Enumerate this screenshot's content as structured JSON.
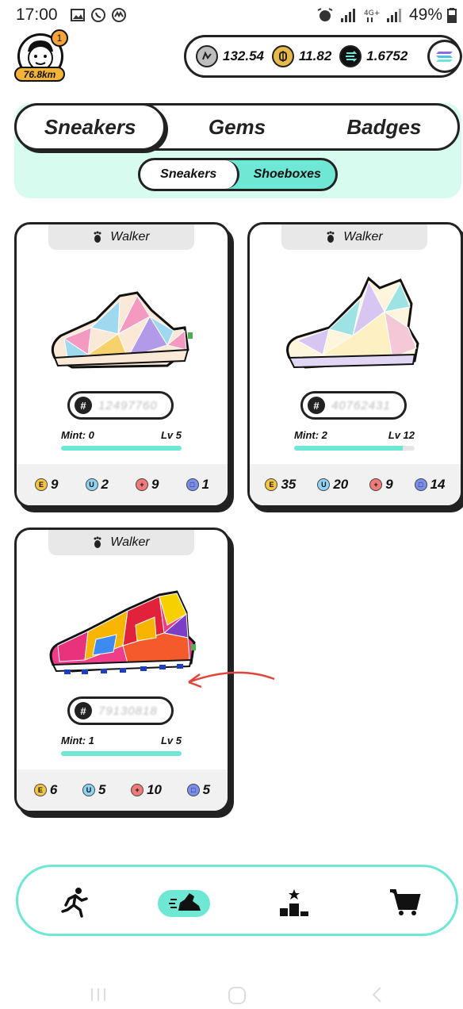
{
  "status_bar": {
    "time": "17:00",
    "battery": "49%"
  },
  "profile": {
    "notification_count": "1",
    "distance": "76.8km"
  },
  "balances": [
    {
      "icon": "gst-coin-icon",
      "value": "132.54"
    },
    {
      "icon": "gmt-coin-icon",
      "value": "11.82"
    },
    {
      "icon": "sol-coin-icon",
      "value": "1.6752"
    }
  ],
  "category_tabs": [
    {
      "label": "Sneakers",
      "active": true
    },
    {
      "label": "Gems",
      "active": false
    },
    {
      "label": "Badges",
      "active": false
    }
  ],
  "sub_tabs": [
    {
      "label": "Sneakers",
      "active": true
    },
    {
      "label": "Shoeboxes",
      "active": false
    }
  ],
  "cards": [
    {
      "type": "Walker",
      "id": "12497760",
      "mint": "Mint: 0",
      "level": "Lv 5",
      "level_progress": 1.0,
      "attributes": {
        "efficiency": "9",
        "luck": "2",
        "comfort": "9",
        "resilience": "1"
      }
    },
    {
      "type": "Walker",
      "id": "40762431",
      "mint": "Mint: 2",
      "level": "Lv 12",
      "level_progress": 0.9,
      "attributes": {
        "efficiency": "35",
        "luck": "20",
        "comfort": "9",
        "resilience": "14"
      }
    },
    {
      "type": "Walker",
      "id": "79130818",
      "mint": "Mint: 1",
      "level": "Lv 5",
      "level_progress": 1.0,
      "attributes": {
        "efficiency": "6",
        "luck": "5",
        "comfort": "10",
        "resilience": "5"
      }
    }
  ],
  "bottom_nav": [
    {
      "icon": "runner-icon",
      "active": false
    },
    {
      "icon": "sneaker-icon",
      "active": true
    },
    {
      "icon": "podium-icon",
      "active": false
    },
    {
      "icon": "cart-icon",
      "active": false
    }
  ],
  "colors": {
    "accent": "#6ee7d5",
    "panel": "#d7fbef",
    "outline": "#222222",
    "annotation": "#e0453a"
  }
}
